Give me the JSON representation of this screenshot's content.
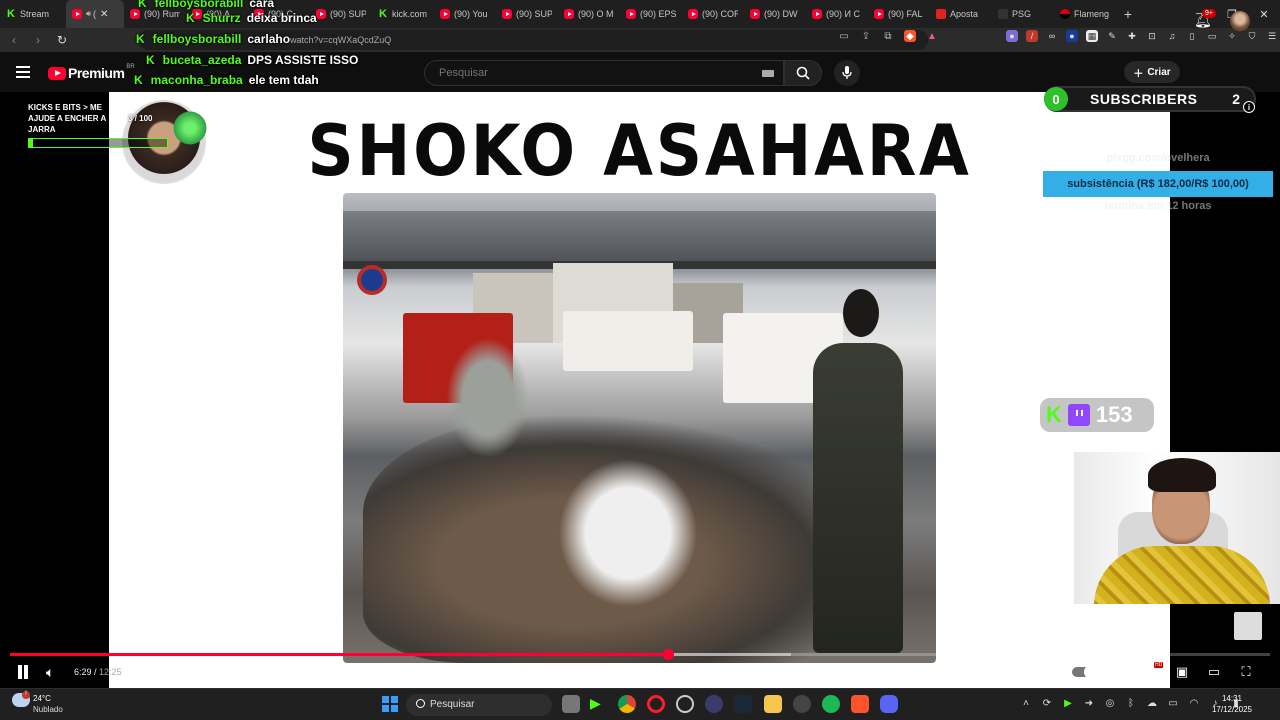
{
  "browser": {
    "tabs": [
      {
        "label": "Stream",
        "icon": "kick-icon"
      },
      {
        "label": "(",
        "icon": "youtube-icon",
        "active": true
      },
      {
        "label": "(90) Rum",
        "icon": "youtube-icon"
      },
      {
        "label": "(90) A",
        "icon": "youtube-icon"
      },
      {
        "label": "(90) C",
        "icon": "youtube-icon"
      },
      {
        "label": "(90) SUP",
        "icon": "youtube-icon"
      },
      {
        "label": "kick.com",
        "icon": "kick-icon"
      },
      {
        "label": "(90) You",
        "icon": "youtube-icon"
      },
      {
        "label": "(90) SUP",
        "icon": "youtube-icon"
      },
      {
        "label": "(90) O M",
        "icon": "youtube-icon"
      },
      {
        "label": "(90) EPS",
        "icon": "youtube-icon"
      },
      {
        "label": "(90) COR",
        "icon": "youtube-icon"
      },
      {
        "label": "(90) DW",
        "icon": "youtube-icon"
      },
      {
        "label": "(90) И С",
        "icon": "youtube-icon"
      },
      {
        "label": "(90) FAL",
        "icon": "youtube-icon"
      },
      {
        "label": "Aposta",
        "icon": "bet-icon"
      },
      {
        "label": "PSG",
        "icon": "psg-icon"
      },
      {
        "label": "Flameng",
        "icon": "flamengo-icon"
      }
    ],
    "new_tab": "+",
    "url": "watch?v=cqWXaQcdZuQ"
  },
  "youtube": {
    "logo_text": "Premium",
    "logo_region": "BR",
    "search_placeholder": "Pesquisar",
    "create_label": "Criar",
    "notif_count": "9+"
  },
  "chat": [
    {
      "user": "fellboysborabill",
      "msg": "cara"
    },
    {
      "user": "Shurrz",
      "msg": "deixa brinca"
    },
    {
      "user": "fellboysborabill",
      "msg": "carlaho"
    },
    {
      "user": "buceta_azeda",
      "msg": "DPS ASSISTE ISSO"
    },
    {
      "user": "maconha_braba",
      "msg": "ele tem tdah"
    }
  ],
  "video": {
    "slide_title": "SHOKO ASAHARA",
    "current_time": "6:29",
    "duration": "12:25",
    "played_fraction": 0.522,
    "buffered_fraction": 0.62
  },
  "overlays": {
    "goal_text": "KICKS E BITS > ME AJUDE A ENCHER A JARRA",
    "goal_current": 3,
    "goal_total": 100,
    "goal_count_text": "3 / 100",
    "subs_left": "0",
    "subs_label": "SUBSCRIBERS",
    "subs_right": "2",
    "pix_link": "pixgg.com/ovelhera",
    "subsistencia": "subsistência (R$ 182,00/R$ 100,00)",
    "subsistencia_end": "termina em 12 horas",
    "viewer_count": "153"
  },
  "taskbar": {
    "temperature": "24°C",
    "weather": "Nublado",
    "search_label": "Pesquisar",
    "time": "14:31",
    "date": "17/12/2025"
  },
  "colors": {
    "kick_green": "#53fc18",
    "youtube_red": "#ff0033",
    "goal_blue": "#34aee6",
    "twitch_purple": "#9146ff"
  }
}
